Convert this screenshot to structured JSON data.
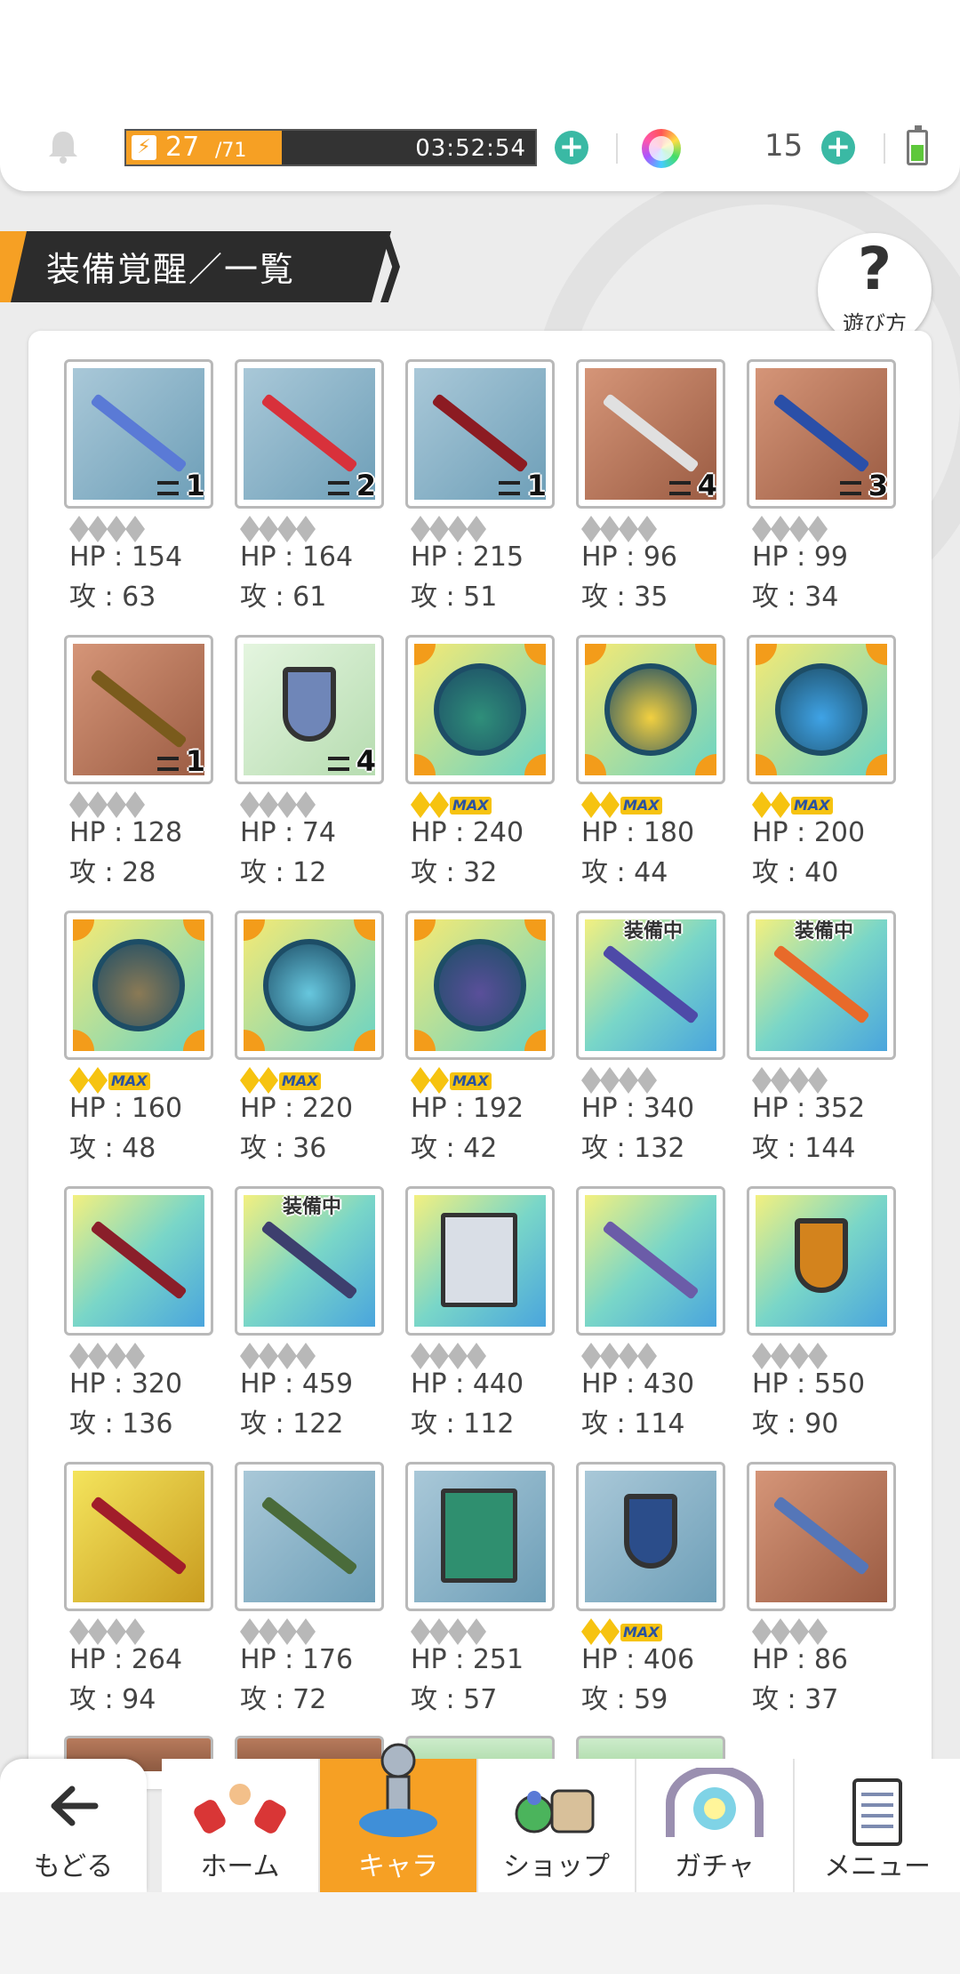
{
  "header": {
    "stamina_current": "27",
    "stamina_max": "/71",
    "stamina_fraction": 0.38,
    "timer": "03:52:54",
    "gem_count": "15"
  },
  "page": {
    "title": "装備覚醒／一覧",
    "help_label": "遊び方",
    "help_glyph": "?"
  },
  "items": [
    {
      "hp": "HP : 154",
      "atk": "攻 : 63",
      "count": "1",
      "bg": "blue",
      "color": "#5a7ad6",
      "ranks": "gray",
      "equipped": ""
    },
    {
      "hp": "HP : 164",
      "atk": "攻 : 61",
      "count": "2",
      "bg": "blue",
      "color": "#d8313b",
      "ranks": "gray",
      "equipped": ""
    },
    {
      "hp": "HP : 215",
      "atk": "攻 : 51",
      "count": "1",
      "bg": "blue",
      "color": "#8c1b22",
      "ranks": "gray",
      "equipped": ""
    },
    {
      "hp": "HP : 96",
      "atk": "攻 : 35",
      "count": "4",
      "bg": "brown",
      "color": "#e0e0e0",
      "ranks": "gray",
      "equipped": ""
    },
    {
      "hp": "HP : 99",
      "atk": "攻 : 34",
      "count": "3",
      "bg": "brown",
      "color": "#2a4fa8",
      "ranks": "gray",
      "equipped": ""
    },
    {
      "hp": "HP : 128",
      "atk": "攻 : 28",
      "count": "1",
      "bg": "brown",
      "color": "#7a5b1c",
      "ranks": "gray",
      "equipped": ""
    },
    {
      "hp": "HP : 74",
      "atk": "攻 : 12",
      "count": "4",
      "bg": "green",
      "color": "#6f86b8",
      "ranks": "gray",
      "equipped": "",
      "shape": "shield"
    },
    {
      "hp": "HP : 240",
      "atk": "攻 : 32",
      "count": "",
      "bg": "orb",
      "color": "#2f8f7a",
      "ranks": "max",
      "equipped": "",
      "shape": "orb"
    },
    {
      "hp": "HP : 180",
      "atk": "攻 : 44",
      "count": "",
      "bg": "orb",
      "color": "#f2d040",
      "ranks": "max",
      "equipped": "",
      "shape": "orb"
    },
    {
      "hp": "HP : 200",
      "atk": "攻 : 40",
      "count": "",
      "bg": "orb",
      "color": "#3fa3e6",
      "ranks": "max",
      "equipped": "",
      "shape": "orb"
    },
    {
      "hp": "HP : 160",
      "atk": "攻 : 48",
      "count": "",
      "bg": "orb",
      "color": "#8b7a55",
      "ranks": "max",
      "equipped": "",
      "shape": "orb"
    },
    {
      "hp": "HP : 220",
      "atk": "攻 : 36",
      "count": "",
      "bg": "orb",
      "color": "#67c7de",
      "ranks": "max",
      "equipped": "",
      "shape": "orb"
    },
    {
      "hp": "HP : 192",
      "atk": "攻 : 42",
      "count": "",
      "bg": "orb",
      "color": "#5a4f9a",
      "ranks": "max",
      "equipped": "",
      "shape": "orb"
    },
    {
      "hp": "HP : 340",
      "atk": "攻 : 132",
      "count": "",
      "bg": "rainbow",
      "color": "#4e4aa8",
      "ranks": "gray",
      "equipped": "装備中"
    },
    {
      "hp": "HP : 352",
      "atk": "攻 : 144",
      "count": "",
      "bg": "rainbow",
      "color": "#e86a2a",
      "ranks": "gray",
      "equipped": "装備中"
    },
    {
      "hp": "HP : 320",
      "atk": "攻 : 136",
      "count": "",
      "bg": "rainbow",
      "color": "#8a1f2a",
      "ranks": "gray",
      "equipped": ""
    },
    {
      "hp": "HP : 459",
      "atk": "攻 : 122",
      "count": "",
      "bg": "rainbow",
      "color": "#3d3f6e",
      "ranks": "gray",
      "equipped": "装備中"
    },
    {
      "hp": "HP : 440",
      "atk": "攻 : 112",
      "count": "",
      "bg": "rainbow",
      "color": "#d9dee6",
      "ranks": "gray",
      "equipped": "",
      "shape": "book"
    },
    {
      "hp": "HP : 430",
      "atk": "攻 : 114",
      "count": "",
      "bg": "rainbow",
      "color": "#6b5ca8",
      "ranks": "gray",
      "equipped": ""
    },
    {
      "hp": "HP : 550",
      "atk": "攻 : 90",
      "count": "",
      "bg": "rainbow",
      "color": "#d3831d",
      "ranks": "gray",
      "equipped": "",
      "shape": "shield"
    },
    {
      "hp": "HP : 264",
      "atk": "攻 : 94",
      "count": "",
      "bg": "gold",
      "color": "#a11d2a",
      "ranks": "gray",
      "equipped": ""
    },
    {
      "hp": "HP : 176",
      "atk": "攻 : 72",
      "count": "",
      "bg": "blue",
      "color": "#4a6b3a",
      "ranks": "gray",
      "equipped": ""
    },
    {
      "hp": "HP : 251",
      "atk": "攻 : 57",
      "count": "",
      "bg": "blue",
      "color": "#2f8f6f",
      "ranks": "gray",
      "equipped": "",
      "shape": "book"
    },
    {
      "hp": "HP : 406",
      "atk": "攻 : 59",
      "count": "",
      "bg": "blue",
      "color": "#2b4d8a",
      "ranks": "max",
      "equipped": "",
      "shape": "shield"
    },
    {
      "hp": "HP : 86",
      "atk": "攻 : 37",
      "count": "",
      "bg": "brown",
      "color": "#5576b8",
      "ranks": "gray",
      "equipped": ""
    }
  ],
  "max_badge": "MAX",
  "nav": {
    "back": "もどる",
    "home": "ホーム",
    "chara": "キャラ",
    "shop": "ショップ",
    "gacha": "ガチャ",
    "menu": "メニュー"
  }
}
